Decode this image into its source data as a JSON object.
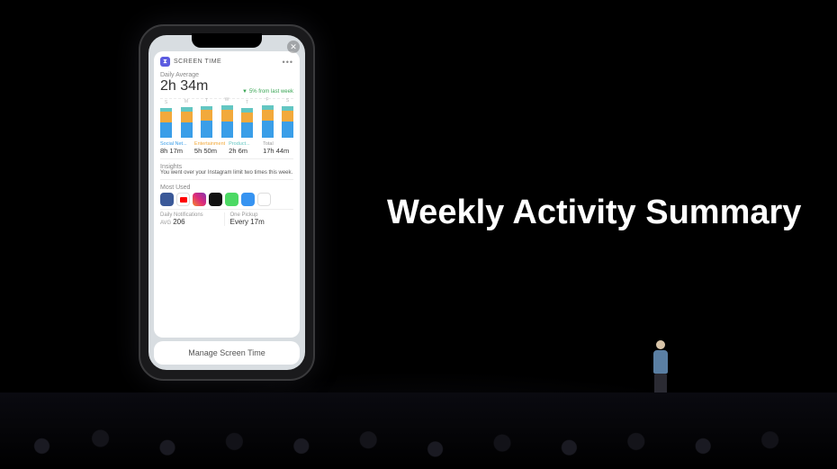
{
  "headline": "Weekly Activity Summary",
  "widget": {
    "title": "SCREEN TIME",
    "daily_average_label": "Daily Average",
    "daily_average_value": "2h 34m",
    "trend_text": "5% from last week",
    "categories": {
      "social": {
        "label": "Social Net...",
        "value": "8h 17m"
      },
      "entertainment": {
        "label": "Entertainment",
        "value": "5h 50m"
      },
      "productivity": {
        "label": "Product...",
        "value": "2h 6m"
      },
      "total": {
        "label": "Total",
        "value": "17h 44m"
      }
    },
    "insights": {
      "label": "Insights",
      "text": "You went over your Instagram limit two times this week."
    },
    "most_used_label": "Most Used",
    "notifications": {
      "label": "Daily Notifications",
      "prefix": "AVG",
      "value": "206"
    },
    "pickup": {
      "label": "One Pickup",
      "value": "Every 17m"
    },
    "manage_label": "Manage Screen Time"
  },
  "chart_data": {
    "type": "bar",
    "categories": [
      "S",
      "M",
      "T",
      "W",
      "T",
      "F",
      "S"
    ],
    "y_unit": "minutes",
    "series": [
      {
        "name": "Social Networking",
        "color": "#3a9ee8",
        "values": [
          70,
          68,
          78,
          72,
          70,
          76,
          74
        ]
      },
      {
        "name": "Entertainment",
        "color": "#f2a93b",
        "values": [
          48,
          52,
          50,
          54,
          46,
          52,
          50
        ]
      },
      {
        "name": "Productivity",
        "color": "#63c6c2",
        "values": [
          18,
          20,
          16,
          22,
          18,
          20,
          18
        ]
      }
    ],
    "title": "Daily Average",
    "ylim": [
      0,
      180
    ]
  }
}
